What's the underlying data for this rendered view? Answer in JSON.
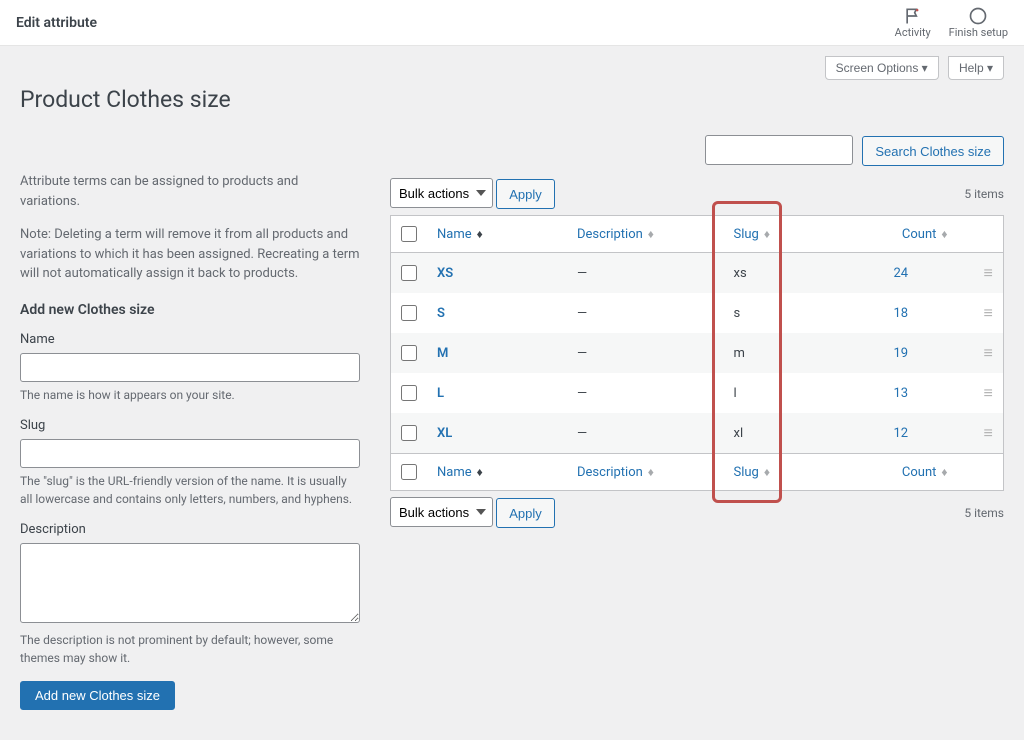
{
  "topbar": {
    "title": "Edit attribute",
    "icons": [
      {
        "name": "activity-icon",
        "label": "Activity"
      },
      {
        "name": "finish-setup-icon",
        "label": "Finish setup"
      }
    ]
  },
  "screen_meta": {
    "screen_options": "Screen Options ▾",
    "help": "Help ▾"
  },
  "page_title": "Product Clothes size",
  "search": {
    "button": "Search Clothes size"
  },
  "left": {
    "intro": "Attribute terms can be assigned to products and variations.",
    "note": "Note: Deleting a term will remove it from all products and variations to which it has been assigned. Recreating a term will not automatically assign it back to products.",
    "heading": "Add new Clothes size",
    "name_label": "Name",
    "name_help": "The name is how it appears on your site.",
    "slug_label": "Slug",
    "slug_help": "The \"slug\" is the URL-friendly version of the name. It is usually all lowercase and contains only letters, numbers, and hyphens.",
    "desc_label": "Description",
    "desc_help": "The description is not prominent by default; however, some themes may show it.",
    "submit": "Add new Clothes size"
  },
  "bulk": {
    "label": "Bulk actions",
    "apply": "Apply"
  },
  "items_count": "5 items",
  "table": {
    "headers": {
      "name": "Name",
      "description": "Description",
      "slug": "Slug",
      "count": "Count"
    },
    "rows": [
      {
        "name": "XS",
        "description": "—",
        "slug": "xs",
        "count": "24"
      },
      {
        "name": "S",
        "description": "—",
        "slug": "s",
        "count": "18"
      },
      {
        "name": "M",
        "description": "—",
        "slug": "m",
        "count": "19"
      },
      {
        "name": "L",
        "description": "—",
        "slug": "l",
        "count": "13"
      },
      {
        "name": "XL",
        "description": "—",
        "slug": "xl",
        "count": "12"
      }
    ]
  }
}
